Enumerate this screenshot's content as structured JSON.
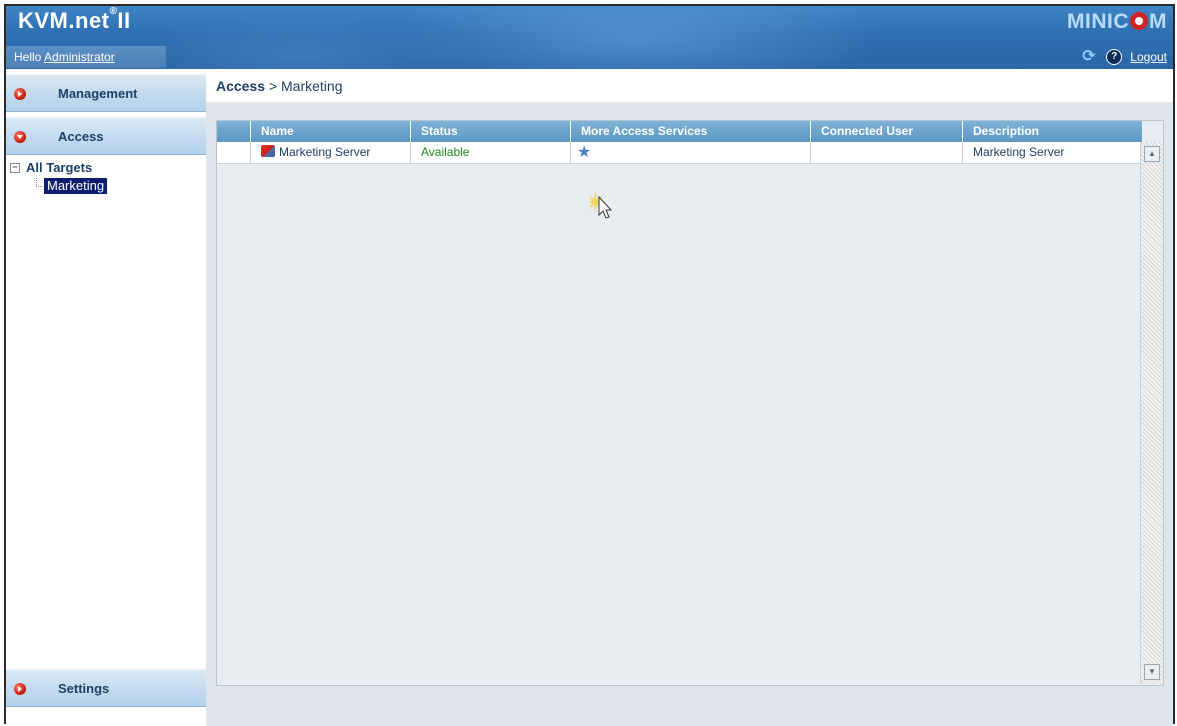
{
  "header": {
    "brand": "KVM.net",
    "brand_super": "®",
    "brand_suffix": "II",
    "greeting_prefix": "Hello",
    "user": "Administrator",
    "logo_prefix": "MINIC",
    "logo_suffix": "M",
    "logout_label": "Logout",
    "accent": "#2d6fb1"
  },
  "sidebar": {
    "nav": [
      {
        "label": "Management"
      },
      {
        "label": "Access"
      },
      {
        "label": "Settings"
      }
    ],
    "tree": {
      "root": "All Targets",
      "items": [
        {
          "label": "Marketing",
          "selected": true
        }
      ]
    }
  },
  "breadcrumb": {
    "section": "Access",
    "separator": ">",
    "current": "Marketing"
  },
  "table": {
    "columns": [
      "Name",
      "Status",
      "More Access Services",
      "Connected User",
      "Description"
    ],
    "rows": [
      {
        "name": "Marketing Server",
        "status": "Available",
        "services_icon": "star-icon",
        "connected_user": "",
        "description": "Marketing Server"
      }
    ],
    "status_color": "#1e8a1e"
  }
}
